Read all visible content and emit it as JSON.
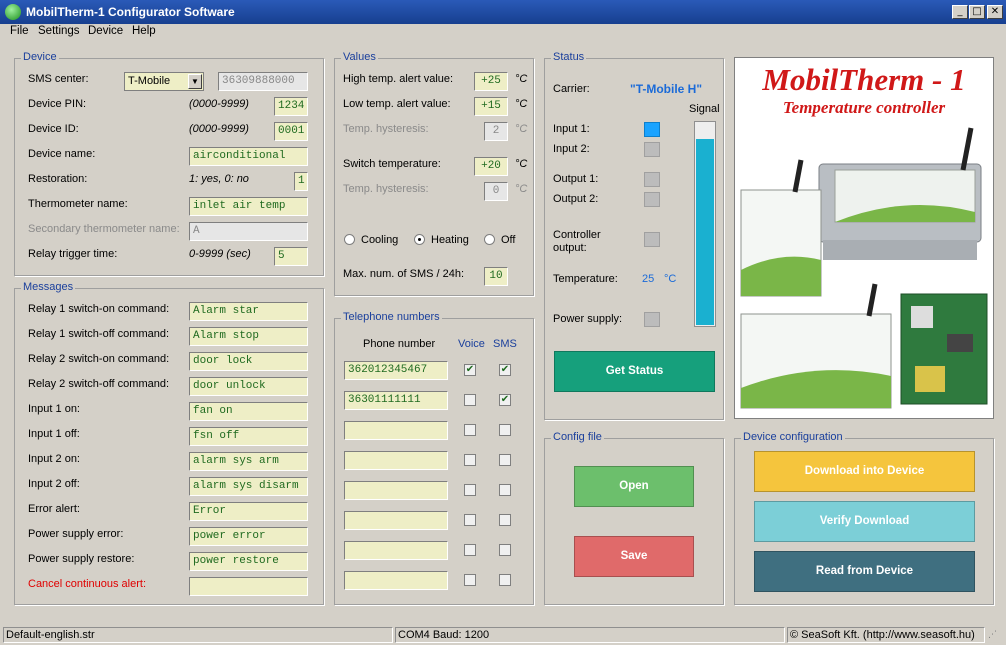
{
  "window": {
    "title": "MobilTherm-1 Configurator Software",
    "minimize": "_",
    "maximize": "□",
    "close": "✕",
    "app_icon": "app-globe-icon"
  },
  "menu": [
    "File",
    "Settings",
    "Device",
    "Help"
  ],
  "device": {
    "group": "Device",
    "sms_center_label": "SMS center:",
    "carrier_select": "T-Mobile",
    "sms_center_number": "36309888000",
    "pin_label": "Device PIN:",
    "pin_hint": "(0000-9999)",
    "pin_value": "1234",
    "id_label": "Device ID:",
    "id_hint": "(0000-9999)",
    "id_value": "0001",
    "name_label": "Device name:",
    "name_value": "airconditional",
    "restoration_label": "Restoration:",
    "restoration_hint": "1: yes, 0: no",
    "restoration_value": "1",
    "thermo_label": "Thermometer name:",
    "thermo_value": "inlet air temp",
    "thermo2_label": "Secondary thermometer name:",
    "thermo2_value": "A",
    "relay_time_label": "Relay trigger time:",
    "relay_time_hint": "0-9999 (sec)",
    "relay_time_value": "5"
  },
  "messages": {
    "group": "Messages",
    "rows": [
      {
        "label": "Relay 1 switch-on command:",
        "value": "Alarm star"
      },
      {
        "label": "Relay 1 switch-off command:",
        "value": "Alarm stop"
      },
      {
        "label": "Relay 2 switch-on command:",
        "value": "door lock"
      },
      {
        "label": "Relay 2 switch-off command:",
        "value": "door  unlock"
      },
      {
        "label": "Input 1 on:",
        "value": "fan on"
      },
      {
        "label": "Input 1 off:",
        "value": "fsn off"
      },
      {
        "label": "Input 2 on:",
        "value": "alarm sys arm"
      },
      {
        "label": "Input 2 off:",
        "value": "alarm sys disarm"
      },
      {
        "label": "Error alert:",
        "value": "Error"
      },
      {
        "label": "Power supply error:",
        "value": "power error"
      },
      {
        "label": "Power supply restore:",
        "value": "power restore"
      },
      {
        "label": "Cancel continuous alert:",
        "value": ""
      }
    ]
  },
  "values": {
    "group": "Values",
    "high_label": "High temp. alert value:",
    "high_value": "+25",
    "low_label": "Low temp. alert value:",
    "low_value": "+15",
    "hyst1_label": "Temp. hysteresis:",
    "hyst1_value": "2",
    "switch_label": "Switch temperature:",
    "switch_value": "+20",
    "hyst2_label": "Temp. hysteresis:",
    "hyst2_value": "0",
    "unit": "°C",
    "mode_cooling": "Cooling",
    "mode_heating": "Heating",
    "mode_off": "Off",
    "selected_mode": "Heating",
    "maxsms_label": "Max. num. of SMS / 24h:",
    "maxsms_value": "10"
  },
  "phones": {
    "group": "Telephone numbers",
    "col_number": "Phone number",
    "col_voice": "Voice",
    "col_sms": "SMS",
    "rows": [
      {
        "number": "362012345467",
        "voice": true,
        "sms": true
      },
      {
        "number": "36301111111",
        "voice": false,
        "sms": true
      },
      {
        "number": "",
        "voice": false,
        "sms": false
      },
      {
        "number": "",
        "voice": false,
        "sms": false
      },
      {
        "number": "",
        "voice": false,
        "sms": false
      },
      {
        "number": "",
        "voice": false,
        "sms": false
      },
      {
        "number": "",
        "voice": false,
        "sms": false
      },
      {
        "number": "",
        "voice": false,
        "sms": false
      }
    ]
  },
  "status": {
    "group": "Status",
    "carrier_label": "Carrier:",
    "carrier_value": "\"T-Mobile H\"",
    "signal_label": "Signal",
    "signal_level": 0.92,
    "input1": "Input 1:",
    "input2": "Input 2:",
    "output1": "Output 1:",
    "output2": "Output 2:",
    "controller_output": "Controller\noutput:",
    "temperature_label": "Temperature:",
    "temperature_value": "25",
    "temperature_unit": "°C",
    "power_label": "Power supply:",
    "get_status": "Get Status"
  },
  "promo": {
    "title": "MobilTherm - 1",
    "subtitle": "Temperature controller"
  },
  "config_file": {
    "group": "Config file",
    "open": "Open",
    "save": "Save"
  },
  "device_config": {
    "group": "Device configuration",
    "download": "Download into Device",
    "verify": "Verify Download",
    "read": "Read from Device"
  },
  "statusbar": {
    "file": "Default-english.str",
    "port": "COM4 Baud: 1200",
    "copyright": "© SeaSoft Kft. (http://www.seasoft.hu)"
  },
  "colors": {
    "label_blue": "#1a3f9c",
    "field_bg": "#eeeec6",
    "field_text": "#1f6a1f",
    "get_status": "#16a07c",
    "open": "#6cbf6c",
    "save": "#e06a6a",
    "download": "#f5c53d",
    "verify": "#7ccfd7",
    "read": "#3f6f80",
    "led_on": "#1aa3ff",
    "signal": "#1ab0d0"
  }
}
